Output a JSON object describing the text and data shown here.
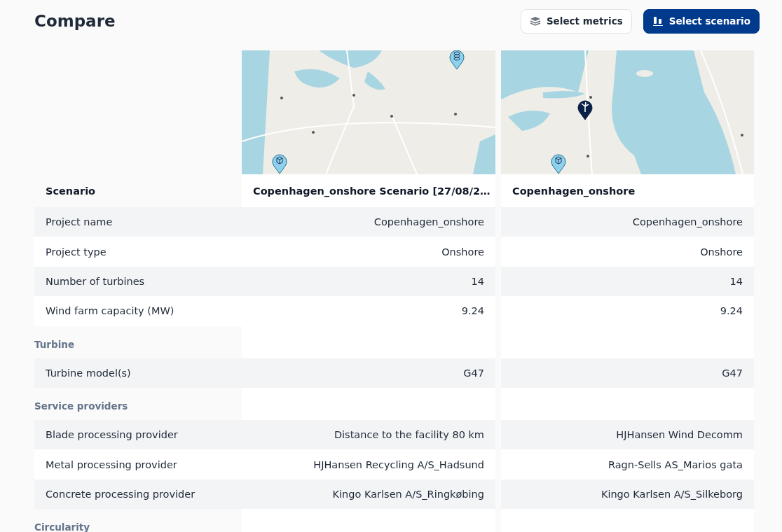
{
  "header": {
    "title": "Compare",
    "buttons": [
      {
        "label": "Select metrics",
        "kind": "secondary"
      },
      {
        "label": "Select scenario",
        "kind": "primary"
      }
    ]
  },
  "table": {
    "corner_label": "Scenario",
    "scenarios": [
      {
        "name": "Copenhagen_onshore Scenario [27/08/2…",
        "map": {
          "kind": "picture",
          "markers": [
            {
              "kind": "stack"
            },
            {
              "kind": "box"
            }
          ]
        }
      },
      {
        "name": "Copenhagen_onshore",
        "map": {
          "kind": "picture",
          "markers": [
            {
              "kind": "turbine"
            },
            {
              "kind": "box"
            }
          ]
        }
      }
    ],
    "sections": [
      {
        "rows": [
          {
            "label": "Project name",
            "values": [
              "Copenhagen_onshore",
              "Copenhagen_onshore"
            ]
          },
          {
            "label": "Project type",
            "values": [
              "Onshore",
              "Onshore"
            ]
          },
          {
            "label": "Number of turbines",
            "values": [
              "14",
              "14"
            ]
          },
          {
            "label": "Wind farm capacity (MW)",
            "values": [
              "9.24",
              "9.24"
            ]
          }
        ]
      },
      {
        "title": "Turbine",
        "rows": [
          {
            "label": "Turbine model(s)",
            "values": [
              "G47",
              "G47"
            ]
          }
        ]
      },
      {
        "title": "Service providers",
        "rows": [
          {
            "label": "Blade processing provider",
            "values": [
              "Distance to the facility 80 km",
              "HJHansen Wind Decomm"
            ]
          },
          {
            "label": "Metal processing provider",
            "values": [
              "HJHansen Recycling A/S_Hadsund",
              "Ragn-Sells AS_Marios gata"
            ]
          },
          {
            "label": "Concrete processing provider",
            "values": [
              "Kingo Karlsen A/S_Ringkøbing",
              "Kingo Karlsen A/S_Silkeborg"
            ]
          }
        ]
      },
      {
        "title": "Circularity"
      }
    ]
  }
}
